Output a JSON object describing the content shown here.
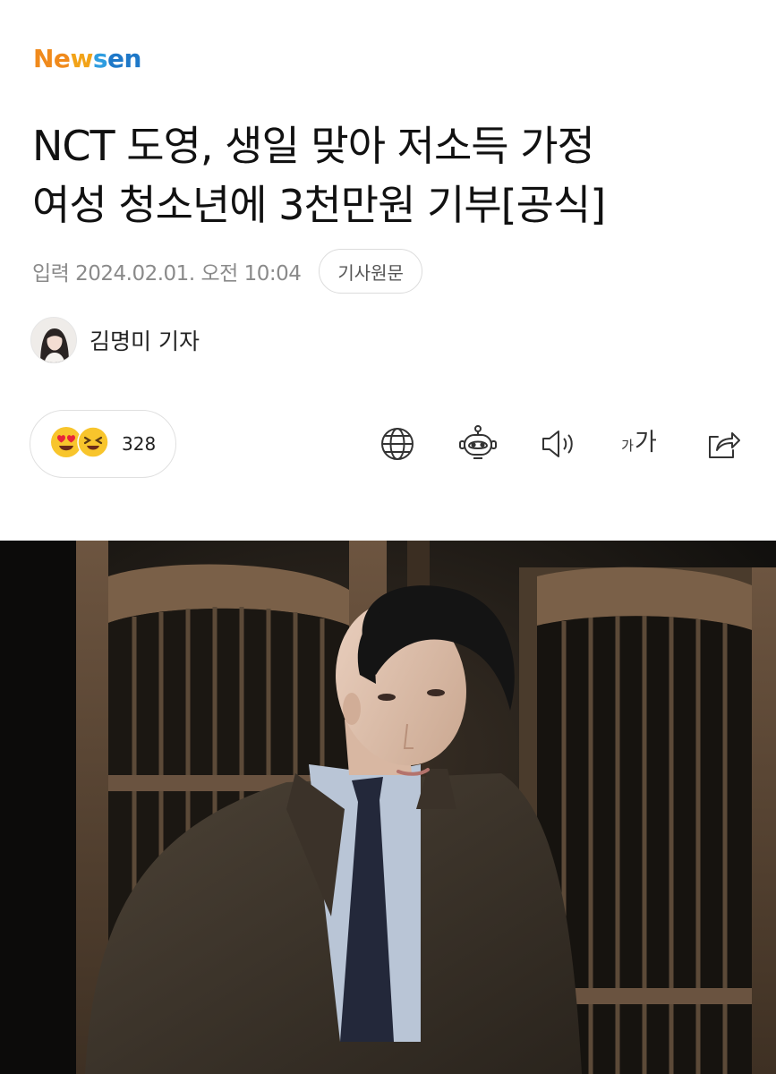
{
  "logo": {
    "letters": [
      "Ne",
      "w",
      "s",
      "en"
    ]
  },
  "headline": {
    "line1": "NCT 도영, 생일 맞아 저소득 가정",
    "line2": "여성 청소년에 3천만원 기부[공식]"
  },
  "meta": {
    "published": "입력 2024.02.01. 오전 10:04",
    "original_button": "기사원문"
  },
  "reporter": {
    "name": "김명미 기자"
  },
  "reactions": {
    "count": "328",
    "emojis": [
      "heart-eyes-emoji",
      "laughing-emoji"
    ]
  },
  "toolbar": {
    "icons": [
      "globe-icon",
      "robot-summary-icon",
      "speaker-icon",
      "font-size-icon",
      "share-icon"
    ],
    "font_small": "가",
    "font_big": "가"
  },
  "colors": {
    "logo_orange": "#f08a1c",
    "logo_blue": "#1e78c8",
    "meta_gray": "#8a8a8a",
    "emoji_yellow": "#f8c52c"
  }
}
